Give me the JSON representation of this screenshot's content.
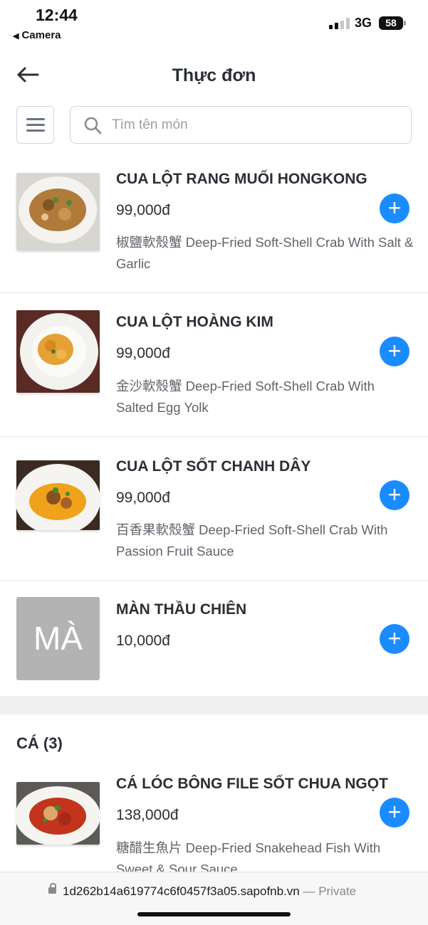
{
  "status_bar": {
    "time": "12:44",
    "back_app": "Camera",
    "network": "3G",
    "battery": "58"
  },
  "header": {
    "title": "Thực đơn"
  },
  "search": {
    "placeholder": "Tìm tên món"
  },
  "items": [
    {
      "name": "CUA LỘT RANG MUỐI HONGKONG",
      "price": "99,000đ",
      "description": "椒鹽軟殼蟹 Deep-Fried Soft-Shell Crab With Salt & Garlic"
    },
    {
      "name": "CUA LỘT HOÀNG KIM",
      "price": "99,000đ",
      "description": "金沙軟殼蟹 Deep-Fried Soft-Shell Crab With Salted Egg Yolk"
    },
    {
      "name": "CUA LỘT SỐT CHANH DÂY",
      "price": "99,000đ",
      "description": "百香果軟殼蟹 Deep-Fried Soft-Shell Crab With Passion Fruit Sauce"
    },
    {
      "name": "MÀN THẦU CHIÊN",
      "price": "10,000đ",
      "placeholder_initials": "MÀ"
    }
  ],
  "section": {
    "title": "CÁ (3)"
  },
  "section_items": [
    {
      "name": "CÁ LÓC BÔNG FILE SỐT CHUA NGỌT",
      "price": "138,000đ",
      "description": "糖醋生魚片 Deep-Fried Snakehead Fish With Sweet & Sour Sauce"
    }
  ],
  "browser": {
    "url": "1d262b14a619774c6f0457f3a05.sapofnb.vn",
    "privacy": " — Private"
  },
  "colors": {
    "accent": "#1a8cff",
    "text": "#2b2f36",
    "muted": "#5f646b"
  },
  "icons": {
    "back": "arrow-left-icon",
    "menu": "hamburger-icon",
    "search": "search-icon",
    "add": "plus-icon",
    "lock": "lock-icon"
  }
}
